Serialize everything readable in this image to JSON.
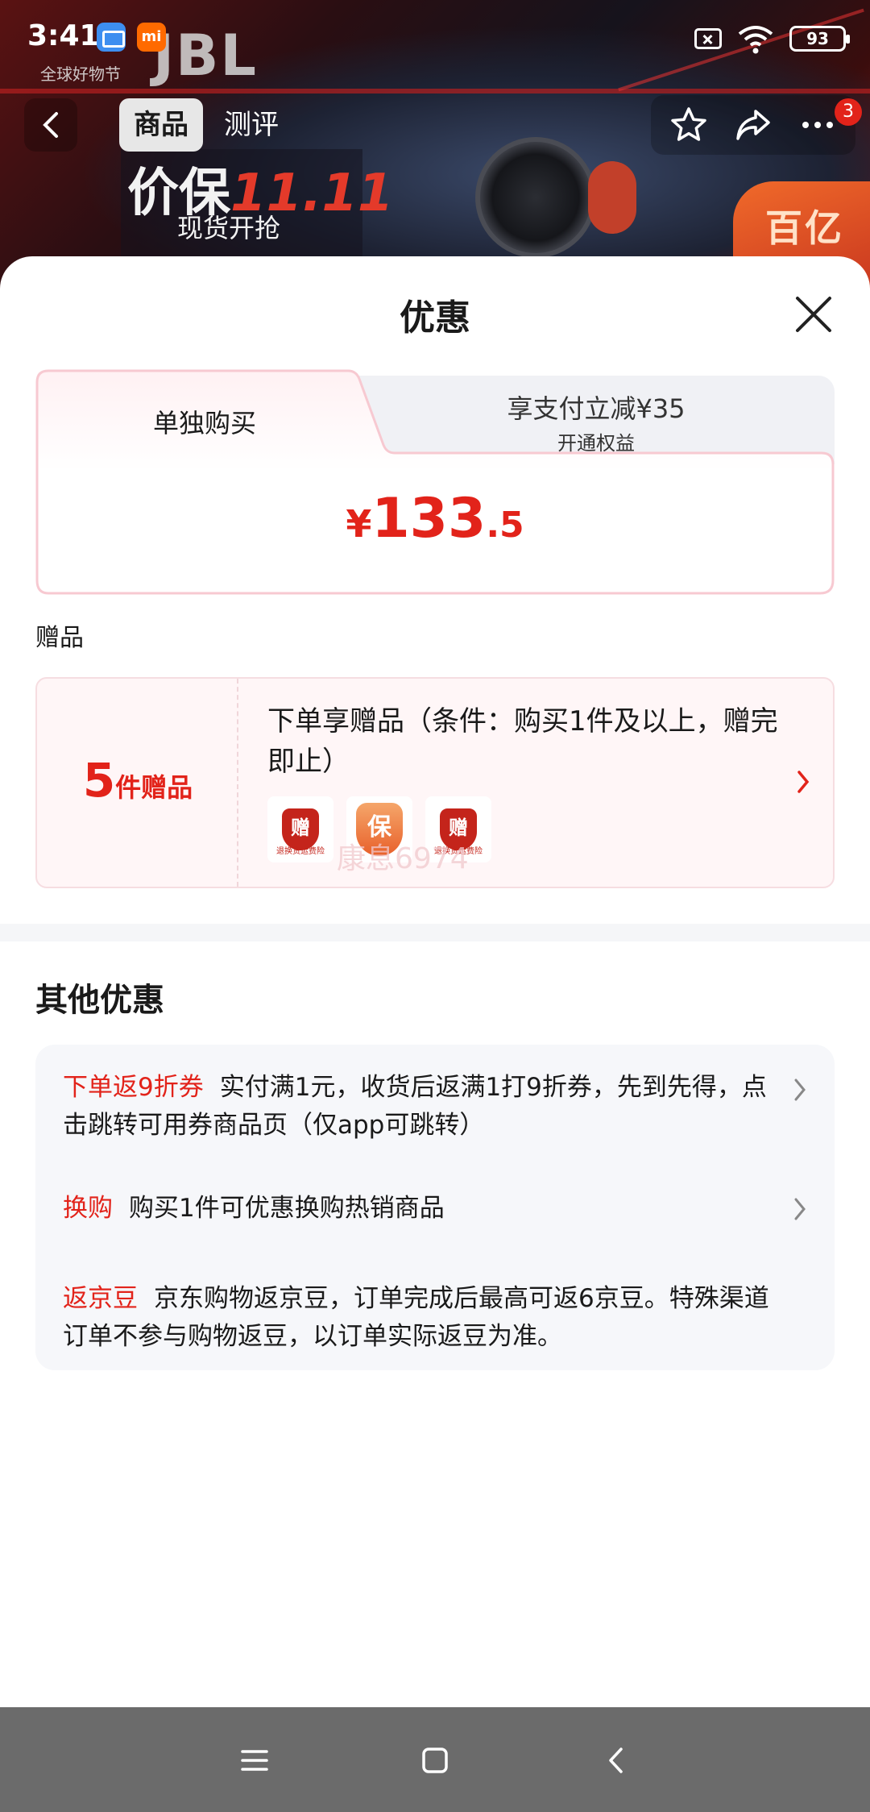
{
  "status_bar": {
    "time": "3:41",
    "mi_label": "mi",
    "battery": "93",
    "icons": [
      "mail-app-icon",
      "mi-app-icon",
      "no-sim-icon",
      "wifi-icon",
      "battery-icon"
    ]
  },
  "background": {
    "brand": "JBL",
    "festival": "全球好物节",
    "promo_prefix": "价保",
    "promo_accent": "11.11",
    "promo_sub": "现货开抢",
    "corner": "百亿"
  },
  "product_nav": {
    "tabs": [
      "商品",
      "测评"
    ],
    "active_tab": 0,
    "message_count": "3",
    "icons": [
      "back-icon",
      "star-icon",
      "share-icon",
      "more-icon"
    ]
  },
  "sheet": {
    "title": "优惠",
    "price_tabs": {
      "left": "单独购买",
      "right_title": "享支付立减¥35",
      "right_sub": "开通权益"
    },
    "price": {
      "symbol": "¥",
      "integer": "133",
      "decimal": ".5"
    },
    "gifts_label": "赠品",
    "gift_card": {
      "count": "5",
      "count_unit": "件赠品",
      "description": "下单享赠品（条件：购买1件及以上，赠完即止）",
      "icons": [
        {
          "mark": "赠",
          "caption": "退换货运费险"
        },
        {
          "mark": "保",
          "caption": ""
        },
        {
          "mark": "赠",
          "caption": "退换货运费险"
        }
      ],
      "watermark": "康息6974"
    },
    "other_title": "其他优惠",
    "offers": [
      {
        "tag": "下单返9折券",
        "text": "实付满1元，收货后返满1打9折券，先到先得，点击跳转可用券商品页（仅app可跳转）",
        "has_arrow": true
      },
      {
        "tag": "换购",
        "text": "购买1件可优惠换购热销商品",
        "has_arrow": true
      },
      {
        "tag": "返京豆",
        "text": "京东购物返京豆，订单完成后最高可返6京豆。特殊渠道订单不参与购物返豆，以订单实际返豆为准。",
        "has_arrow": false
      }
    ]
  },
  "system_nav": {
    "icons": [
      "menu-icon",
      "home-icon",
      "back-nav-icon"
    ]
  },
  "colors": {
    "accent_red": "#e2231a",
    "gift_bg": "#fff6f7",
    "offer_bg": "#f6f7fa",
    "sheet_bg": "#ffffff",
    "nav_bar": "#6b6b6b"
  }
}
